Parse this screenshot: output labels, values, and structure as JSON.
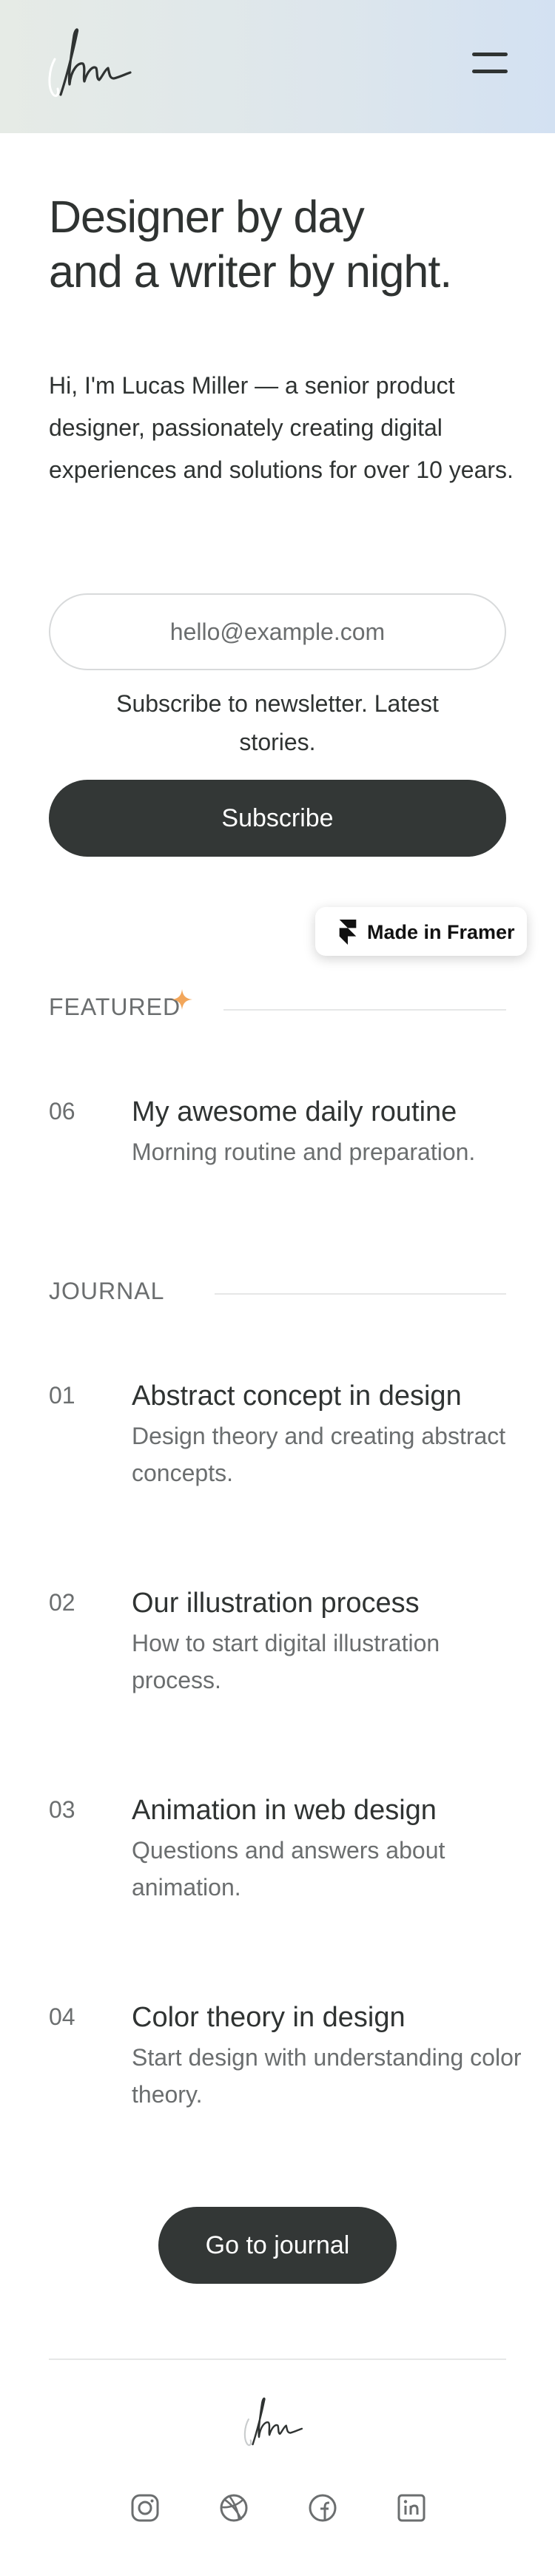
{
  "header": {
    "logo_icon": "signature-logo-icon",
    "menu_icon": "hamburger-menu-icon"
  },
  "hero": {
    "title_line1": "Designer by day",
    "title_line2": "and a writer by night.",
    "intro": "Hi, I'm Lucas Miller — a senior product designer, passionately creating digital experiences and solutions for over 10 years."
  },
  "newsletter": {
    "placeholder": "hello@example.com",
    "note": "Subscribe to newsletter. Latest stories.",
    "button_label": "Subscribe"
  },
  "badge": {
    "label": "Made in Framer",
    "icon": "framer-logo-icon"
  },
  "featured": {
    "label": "FEATURED",
    "accent_color": "#f2a65a",
    "posts": [
      {
        "number": "06",
        "title": "My awesome daily routine",
        "description": "Morning routine and preparation."
      }
    ]
  },
  "journal": {
    "label": "JOURNAL",
    "posts": [
      {
        "number": "01",
        "title": "Abstract concept in design",
        "description": "Design theory and creating abstract concepts."
      },
      {
        "number": "02",
        "title": "Our illustration process",
        "description": "How to start digital illustration process."
      },
      {
        "number": "03",
        "title": "Animation in web design",
        "description": "Questions and answers about animation."
      },
      {
        "number": "04",
        "title": "Color theory in design",
        "description": "Start design with understanding color theory."
      }
    ],
    "button_label": "Go to journal"
  },
  "footer": {
    "social_icons": [
      "instagram-icon",
      "dribbble-icon",
      "facebook-icon",
      "linkedin-icon"
    ]
  },
  "colors": {
    "dark_button": "#333736",
    "text_primary": "#2f3332",
    "text_muted": "#6b6e6f",
    "header_gradient_start": "#e6ebe6",
    "header_gradient_end": "#d3e1f2"
  }
}
